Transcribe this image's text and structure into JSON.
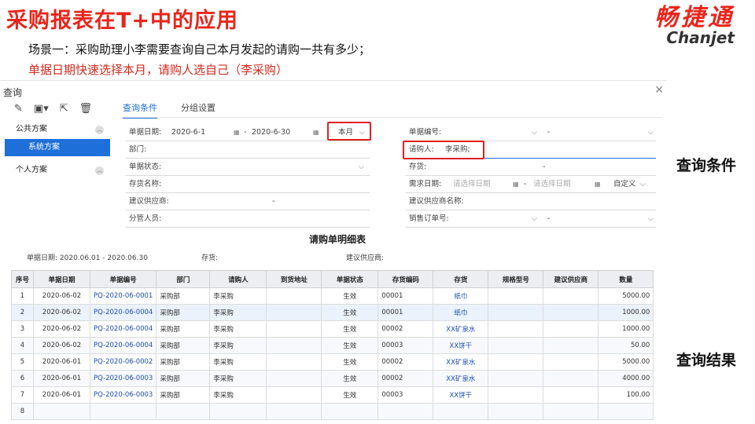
{
  "slide": {
    "title": "采购报表在T+中的应用",
    "scene_line1": "场景一：采购助理小李需要查询自己本月发起的请购一共有多少；",
    "scene_line2": "单据日期快速选择本月，请购人选自己（李采购）",
    "side_label_conditions": "查询条件",
    "side_label_results": "查询结果"
  },
  "logo": {
    "cn": "畅捷通",
    "en": "Chanjet",
    "color": "#e8261c"
  },
  "window": {
    "title": "查询",
    "close_icon": "close-icon",
    "toolbar_icons": [
      "edit-icon",
      "save-icon",
      "export-icon",
      "delete-icon"
    ],
    "tabs": [
      "查询条件",
      "分组设置"
    ],
    "active_tab": "查询条件"
  },
  "sidebar": {
    "group1": "公共方案",
    "group1_item": "系统方案",
    "group2": "个人方案"
  },
  "form": {
    "doc_date_label": "单据日期:",
    "date_from": "2020-6-1",
    "date_sep": "-",
    "date_to": "2020-6-30",
    "period": "本月",
    "dept_label": "部门:",
    "status_label": "单据状态:",
    "stock_name_label": "存货名称:",
    "supplier_label": "建议供应商:",
    "supplier_dash": "-",
    "manager_label": "分管人员:",
    "doc_no_label": "单据编号:",
    "doc_no_dash": "-",
    "requester_label": "请购人:",
    "requester_value": "李采购;",
    "stock_label": "存货:",
    "stock_dash": "-",
    "need_date_label": "需求日期:",
    "need_date_from_ph": "请选择日期",
    "need_date_to_ph": "请选择日期",
    "need_date_mode": "自定义",
    "supplier_name_label": "建议供应商名称:",
    "sales_order_label": "销售订单号:",
    "sales_order_dash": "-"
  },
  "report": {
    "title": "请购单明细表",
    "meta_date": "单据日期: 2020.06.01 - 2020.06.30",
    "meta_stock": "存货:",
    "meta_supplier": "建议供应商:",
    "columns": [
      "序号",
      "单据日期",
      "单据编号",
      "部门",
      "请购人",
      "到货地址",
      "单据状态",
      "存货编码",
      "存货",
      "规格型号",
      "建议供应商",
      "数量"
    ],
    "rows": [
      [
        "1",
        "2020-06-02",
        "PQ-2020-06-0001",
        "采购部",
        "李采购",
        "",
        "生效",
        "00001",
        "纸巾",
        "",
        "",
        "5000.00"
      ],
      [
        "2",
        "2020-06-02",
        "PQ-2020-06-0004",
        "采购部",
        "李采购",
        "",
        "生效",
        "00001",
        "纸巾",
        "",
        "",
        "1000.00"
      ],
      [
        "3",
        "2020-06-02",
        "PQ-2020-06-0004",
        "采购部",
        "李采购",
        "",
        "生效",
        "00002",
        "XX矿泉水",
        "",
        "",
        "1000.00"
      ],
      [
        "4",
        "2020-06-02",
        "PQ-2020-06-0004",
        "采购部",
        "李采购",
        "",
        "生效",
        "00003",
        "XX饼干",
        "",
        "",
        "50.00"
      ],
      [
        "5",
        "2020-06-01",
        "PQ-2020-06-0002",
        "采购部",
        "李采购",
        "",
        "生效",
        "00002",
        "XX矿泉水",
        "",
        "",
        "5000.00"
      ],
      [
        "6",
        "2020-06-01",
        "PQ-2020-06-0003",
        "采购部",
        "李采购",
        "",
        "生效",
        "00002",
        "XX矿泉水",
        "",
        "",
        "4000.00"
      ],
      [
        "7",
        "2020-06-01",
        "PQ-2020-06-0003",
        "采购部",
        "李采购",
        "",
        "生效",
        "00003",
        "XX饼干",
        "",
        "",
        "100.00"
      ],
      [
        "8",
        "",
        "",
        "",
        "",
        "",
        "",
        "",
        "",
        "",
        "",
        ""
      ]
    ]
  }
}
